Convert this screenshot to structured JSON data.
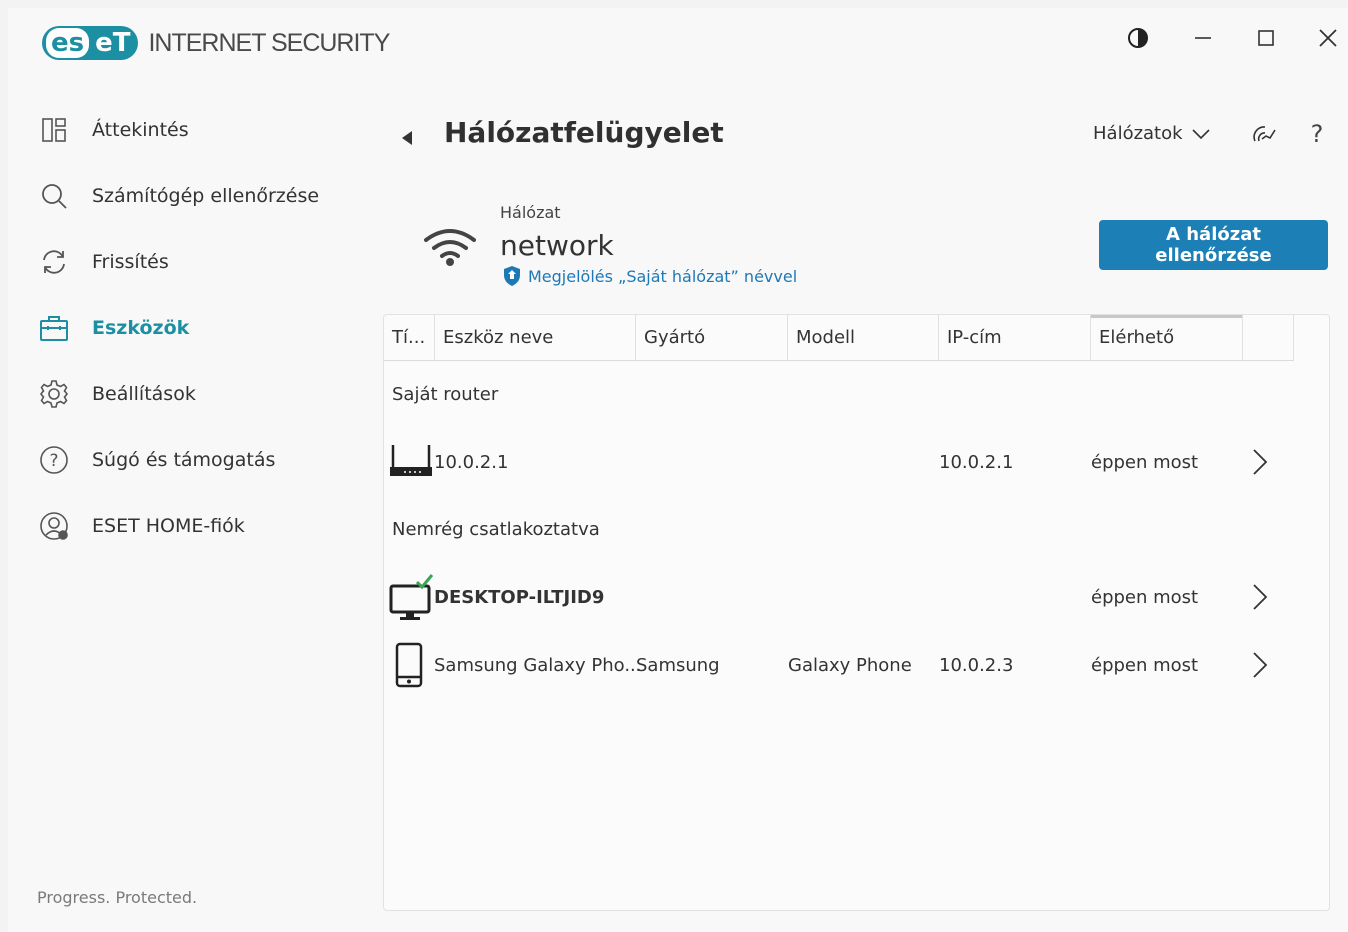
{
  "app": {
    "logo_text_left": "es",
    "logo_text_right": "eT",
    "product": "INTERNET SECURITY",
    "accent": "#1d8fa3",
    "button_color": "#1c7fb5"
  },
  "window_controls": [
    "contrast-icon",
    "minimize-icon",
    "maximize-icon",
    "close-icon"
  ],
  "sidebar": {
    "items": [
      {
        "label": "Áttekintés",
        "icon": "overview-icon"
      },
      {
        "label": "Számítógép ellenőrzése",
        "icon": "search-icon"
      },
      {
        "label": "Frissítés",
        "icon": "refresh-icon"
      },
      {
        "label": "Eszközök",
        "icon": "briefcase-icon",
        "active": true
      },
      {
        "label": "Beállítások",
        "icon": "gear-icon"
      },
      {
        "label": "Súgó és támogatás",
        "icon": "help-icon"
      },
      {
        "label": "ESET HOME-fiók",
        "icon": "account-icon"
      }
    ],
    "footer": "Progress. Protected."
  },
  "header": {
    "title": "Hálózatfelügyelet",
    "networks_dropdown": "Hálózatok",
    "icons": [
      "connections-icon",
      "help-icon"
    ]
  },
  "network": {
    "caption": "Hálózat",
    "name": "network",
    "mark_link": "Megjelölés „Saját hálózat” névvel",
    "scan_button": "A hálózat ellenőrzése"
  },
  "table": {
    "columns": [
      "Tí...",
      "Eszköz neve",
      "Gyártó",
      "Modell",
      "IP-cím",
      "Elérhető"
    ],
    "groups": [
      {
        "label": "Saját router",
        "rows": [
          {
            "type_icon": "router-icon",
            "name": "10.0.2.1",
            "vendor": "",
            "model": "",
            "ip": "10.0.2.1",
            "seen": "éppen most"
          }
        ]
      },
      {
        "label": "Nemrég csatlakoztatva",
        "rows": [
          {
            "type_icon": "desktop-icon",
            "name": "DESKTOP-ILTJID9",
            "vendor": "",
            "model": "",
            "ip": "",
            "seen": "éppen most"
          },
          {
            "type_icon": "phone-icon",
            "name": "Samsung Galaxy Pho...",
            "vendor": "Samsung",
            "model": "Galaxy Phone",
            "ip": "10.0.2.3",
            "seen": "éppen most"
          }
        ]
      }
    ]
  }
}
